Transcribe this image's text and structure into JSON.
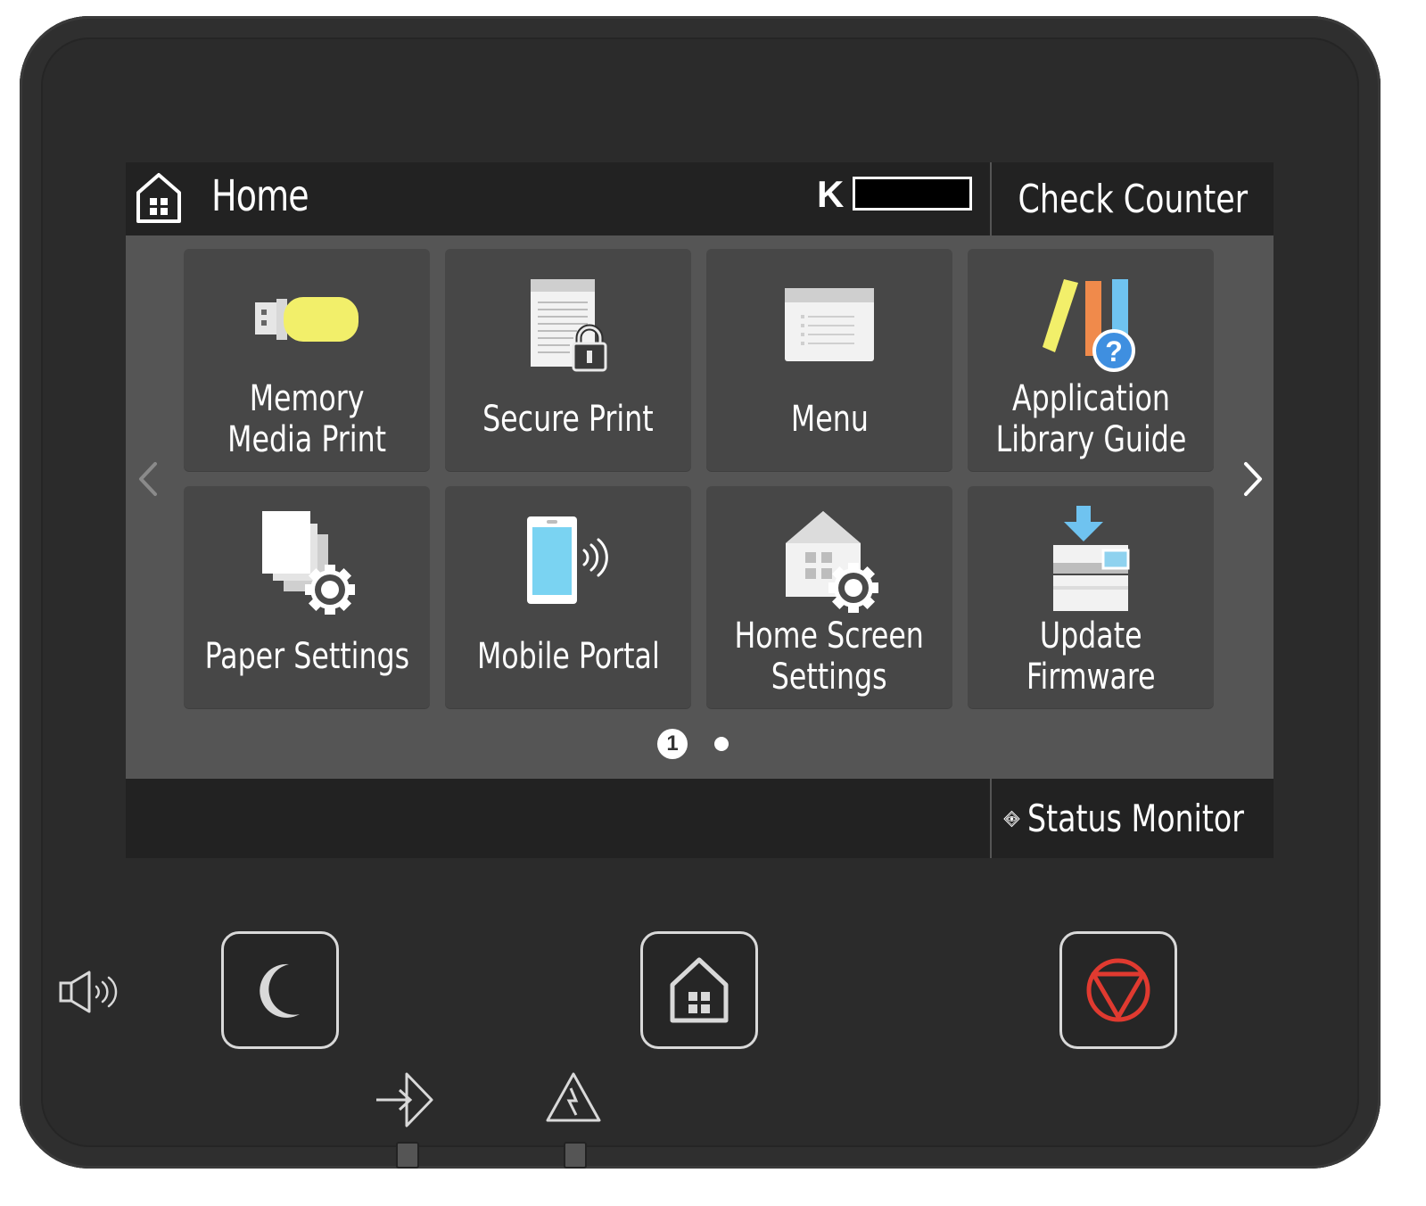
{
  "header": {
    "title": "Home",
    "toner_label": "K",
    "toner_level": 1.0,
    "check_counter_label": "Check Counter"
  },
  "tiles": [
    {
      "label": "Memory\nMedia Print",
      "icon": "usb-memory-icon"
    },
    {
      "label": "Secure Print",
      "icon": "locked-document-icon"
    },
    {
      "label": "Menu",
      "icon": "menu-list-icon"
    },
    {
      "label": "Application\nLibrary Guide",
      "icon": "library-guide-icon"
    },
    {
      "label": "Paper Settings",
      "icon": "paper-settings-icon"
    },
    {
      "label": "Mobile Portal",
      "icon": "mobile-portal-icon"
    },
    {
      "label": "Home Screen\nSettings",
      "icon": "home-screen-settings-icon"
    },
    {
      "label": "Update\nFirmware",
      "icon": "update-firmware-icon"
    }
  ],
  "pager": {
    "current": "1",
    "total_pages": 2
  },
  "footer": {
    "status_monitor_label": "Status Monitor"
  },
  "colors": {
    "screen_bg": "#555555",
    "tile_bg": "#474747",
    "bar_bg": "#222222",
    "device_body": "#2b2b2b",
    "stop_red": "#e03a30",
    "usb_yellow": "#f2ef6a",
    "phone_blue": "#7ad3f2"
  },
  "hardware": {
    "buttons": [
      "energy-saver-button",
      "home-button",
      "stop-button"
    ],
    "indicators": [
      "data-indicator",
      "error-indicator"
    ]
  }
}
